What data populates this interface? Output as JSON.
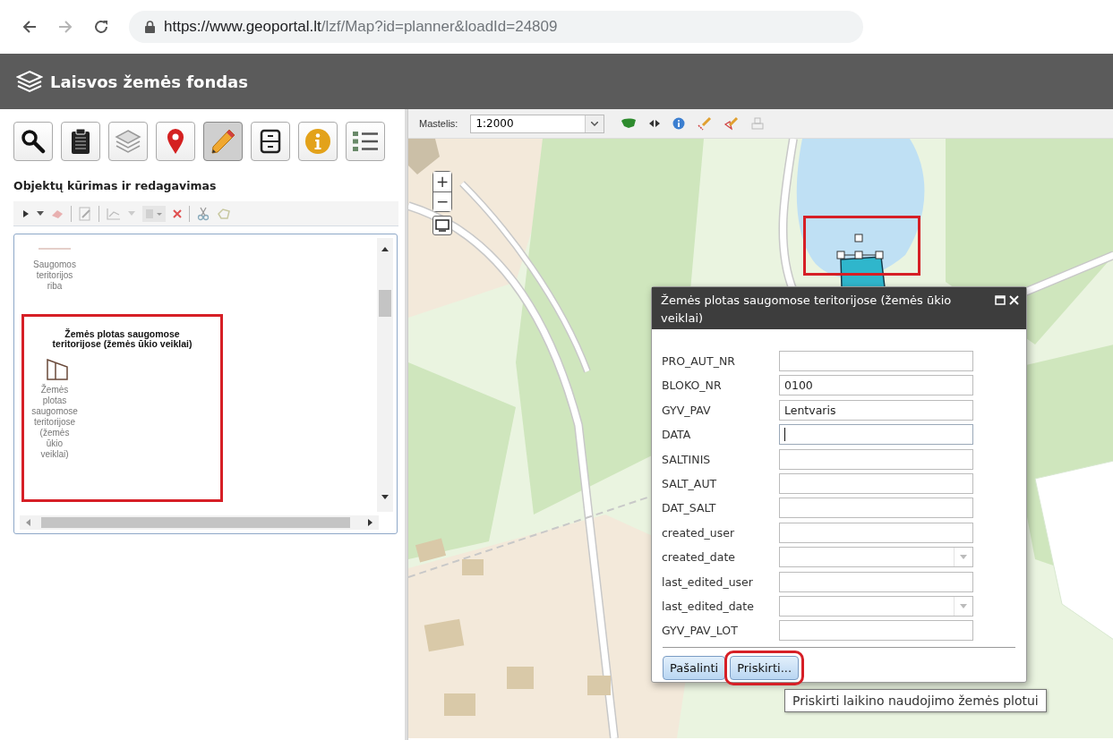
{
  "browser": {
    "nav": [
      {
        "kind": "back",
        "disabled": false
      },
      {
        "kind": "forward",
        "disabled": true
      },
      {
        "kind": "reload",
        "disabled": false
      }
    ],
    "url": {
      "host": "https://www.geoportal.lt",
      "path": "/lzf/Map?id=planner&loadId=24809"
    }
  },
  "app": {
    "title": "Laisvos žemės fondas"
  },
  "tools": [
    {
      "kind": "search",
      "selected": false
    },
    {
      "kind": "clipboard",
      "selected": false
    },
    {
      "kind": "layers",
      "selected": false
    },
    {
      "kind": "pin",
      "selected": false
    },
    {
      "kind": "pencil",
      "selected": true
    },
    {
      "kind": "cabinet",
      "selected": false
    },
    {
      "kind": "info",
      "selected": false
    },
    {
      "kind": "list",
      "selected": false
    }
  ],
  "panel": {
    "heading": "Objektų kūrimas ir redagavimas",
    "templates": [
      {
        "kind": "line",
        "label": "Saugomos teritorijos riba",
        "highlighted": false
      },
      {
        "kind": "polygon",
        "heading": "Žemės plotas saugomose teritorijose (žemės ūkio veiklai)",
        "label": "Žemės plotas saugomose teritorijose (žemės ūkio veiklai)",
        "highlighted": true
      }
    ]
  },
  "map_toolbar": {
    "scale_label": "Mastelis:",
    "scale_value": "1:2000"
  },
  "zoom": {
    "in": "+",
    "out": "−"
  },
  "map": {
    "selection_highlighted": true
  },
  "dialog": {
    "title": "Žemės plotas saugomose teritorijose (žemės ūkio veiklai)",
    "fields": [
      {
        "label": "PRO_AUT_NR",
        "kind": "text",
        "focused": false
      },
      {
        "label": "BLOKO_NR",
        "kind": "text",
        "value": "0100",
        "focused": false
      },
      {
        "label": "GYV_PAV",
        "kind": "text",
        "value": "Lentvaris",
        "focused": false
      },
      {
        "label": "DATA",
        "kind": "text",
        "focused": true
      },
      {
        "label": "SALTINIS",
        "kind": "text",
        "focused": false
      },
      {
        "label": "SALT_AUT",
        "kind": "text",
        "focused": false
      },
      {
        "label": "DAT_SALT",
        "kind": "text",
        "focused": false
      },
      {
        "label": "created_user",
        "kind": "text",
        "focused": false
      },
      {
        "label": "created_date",
        "kind": "date",
        "focused": false
      },
      {
        "label": "last_edited_user",
        "kind": "text",
        "focused": false
      },
      {
        "label": "last_edited_date",
        "kind": "date",
        "focused": false
      },
      {
        "label": "GYV_PAV_LOT",
        "kind": "text",
        "focused": false
      }
    ],
    "buttons": [
      {
        "label": "Pašalinti",
        "highlighted": false
      },
      {
        "label": "Priskirti...",
        "highlighted": true
      }
    ]
  },
  "tooltip": {
    "text": "Priskirti laikino naudojimo žemės plotui"
  }
}
